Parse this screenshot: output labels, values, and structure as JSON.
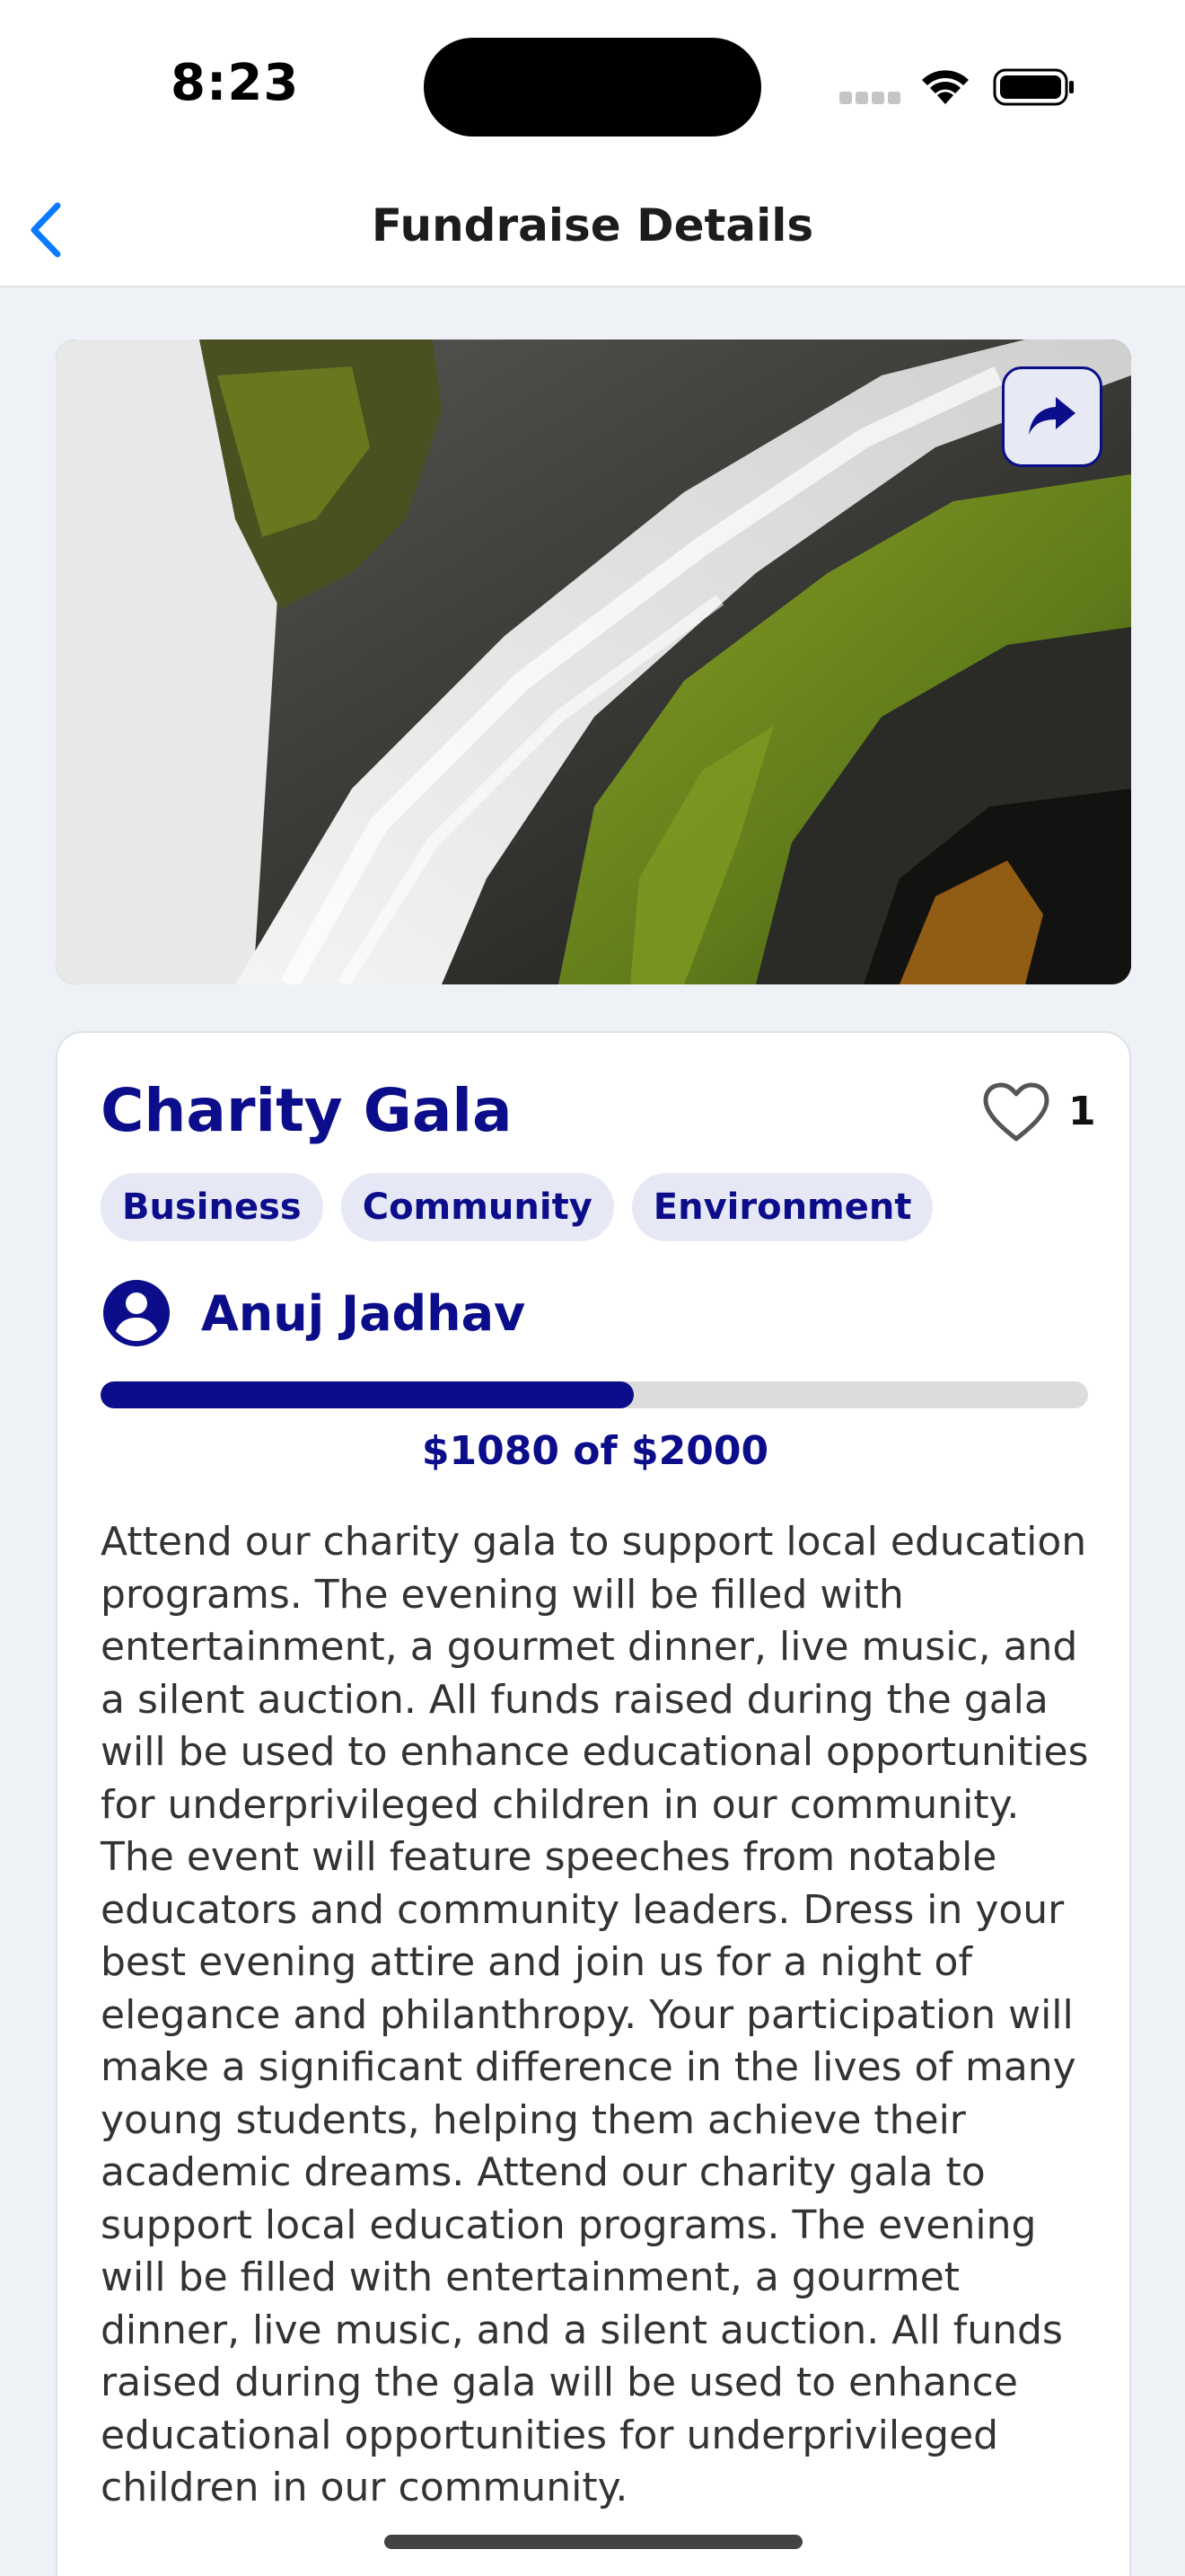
{
  "status_bar": {
    "time": "8:23"
  },
  "nav": {
    "title": "Fundraise Details"
  },
  "fundraiser": {
    "title": "Charity Gala",
    "likes": "1",
    "tags": [
      "Business",
      "Community",
      "Environment"
    ],
    "organizer": "Anuj Jadhav",
    "raised": 1080,
    "goal": 2000,
    "progress_text": "$1080 of $2000",
    "description": "Attend our charity gala to support local education programs. The evening will be filled with entertainment, a gourmet dinner, live music, and a silent auction. All funds raised during the gala will be used to enhance educational opportunities for underprivileged children in our community. The event will feature speeches from notable educators and community leaders. Dress in your best evening attire and join us for a night of elegance and philanthropy. Your participation will make a significant difference in the lives of many young students, helping them achieve their academic dreams. Attend our charity gala to support local education programs. The evening will be filled with entertainment, a gourmet dinner, live music, and a silent auction. All funds raised during the gala will be used to enhance educational opportunities for underprivileged children in our community."
  },
  "colors": {
    "accent": "#0b0d8a",
    "tag_bg": "#e6e8f6",
    "ios_blue": "#0a7aff",
    "track": "#dcdcdc"
  },
  "icons": {
    "back": "chevron-left-icon",
    "share": "share-arrow-icon",
    "like": "heart-outline-icon",
    "avatar": "user-circle-icon"
  }
}
